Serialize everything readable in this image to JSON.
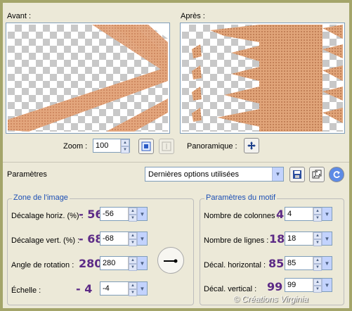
{
  "preview": {
    "before_label": "Avant :",
    "after_label": "Après :",
    "zoom_label": "Zoom :",
    "zoom_value": "100",
    "pan_label": "Panoramique :"
  },
  "presets": {
    "label": "Paramètres",
    "selected": "Dernières options utilisées"
  },
  "image_zone": {
    "title": "Zone de l'image",
    "fields": [
      {
        "label": "Décalage horiz. (%) :",
        "annotation": "- 56",
        "value": "-56"
      },
      {
        "label": "Décalage vert. (%) :",
        "annotation": "- 68",
        "value": "-68"
      },
      {
        "label": "Angle de rotation :",
        "annotation": "280",
        "value": "280"
      },
      {
        "label": "Échelle :",
        "annotation": "- 4",
        "value": "-4"
      }
    ]
  },
  "pattern": {
    "title": "Paramètres du motif",
    "fields": [
      {
        "label": "Nombre de colonnes :",
        "annotation": "4",
        "value": "4"
      },
      {
        "label": "Nombre de lignes :",
        "annotation": "18",
        "value": "18"
      },
      {
        "label": "Décal. horizontal :",
        "annotation": "85",
        "value": "85"
      },
      {
        "label": "Décal. vertical :",
        "annotation": "99",
        "value": "99"
      }
    ]
  },
  "watermark": "© Créations Virginia",
  "colors": {
    "accent_purple": "#5c2a86",
    "group_title_blue": "#1c4fb5",
    "texture_peach": "#e0a479"
  }
}
